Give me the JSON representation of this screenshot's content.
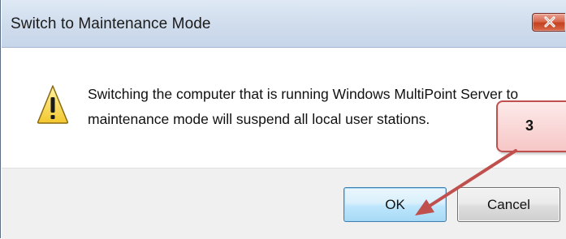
{
  "dialog": {
    "title": "Switch to Maintenance Mode",
    "message": "Switching the computer that is running Windows MultiPoint Server to maintenance mode will suspend all local user stations.",
    "icon": "warning-icon",
    "close_icon": "close-icon"
  },
  "buttons": {
    "ok_label": "OK",
    "cancel_label": "Cancel"
  },
  "annotation": {
    "callout_label": "3",
    "callout_color": "#c0504d"
  },
  "colors": {
    "titlebar": "#cfdcec",
    "close_button": "#c4411f",
    "ok_button_border": "#3c7fb1",
    "footer": "#f0f0f0"
  }
}
